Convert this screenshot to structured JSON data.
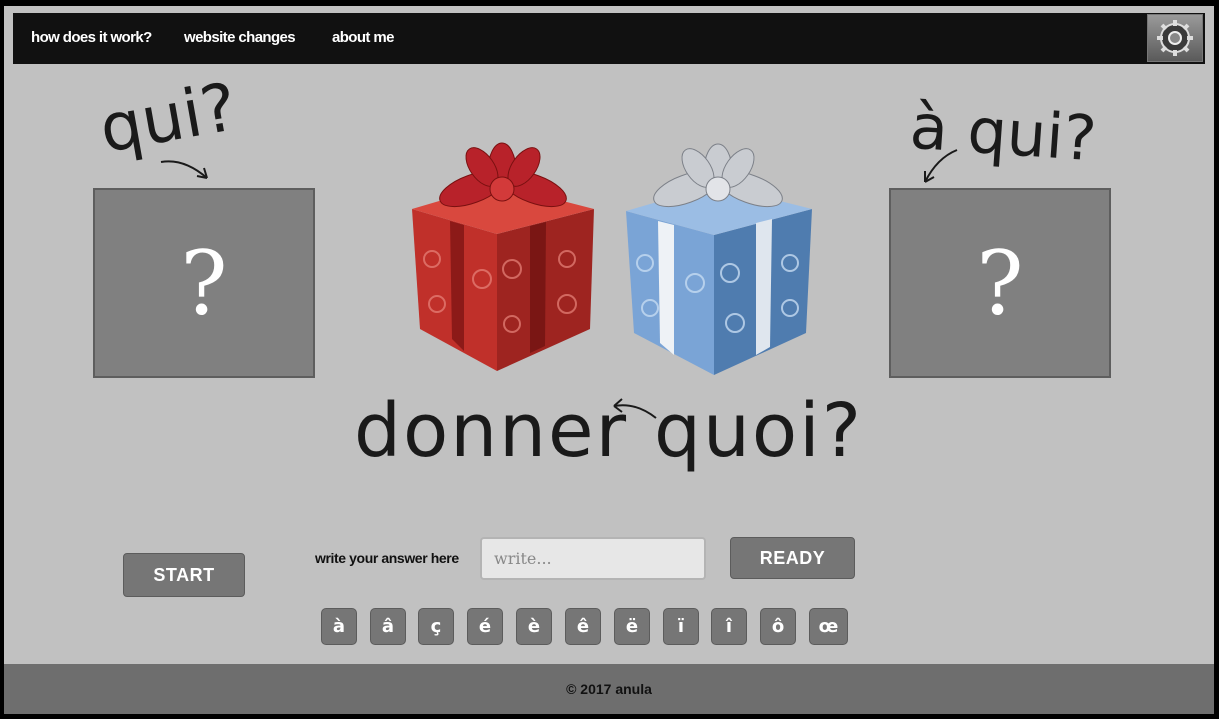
{
  "nav": {
    "items": [
      {
        "label": "how does it work?"
      },
      {
        "label": "website changes"
      },
      {
        "label": "about me"
      }
    ],
    "settings_icon": "gear-icon"
  },
  "left_panel": {
    "heading": "qui?",
    "placeholder": "?"
  },
  "right_panel": {
    "heading": "à qui?",
    "placeholder": "?"
  },
  "center": {
    "verb": "donner",
    "question": "quoi?",
    "gifts": [
      "red-gift-icon",
      "blue-gift-icon"
    ]
  },
  "controls": {
    "start_label": "START",
    "answer_label": "write your answer here",
    "answer_placeholder": "write...",
    "answer_value": "",
    "ready_label": "READY"
  },
  "special_chars": [
    "à",
    "â",
    "ç",
    "é",
    "è",
    "ê",
    "ë",
    "ï",
    "î",
    "ô",
    "œ"
  ],
  "footer": {
    "text": "© 2017 anula"
  },
  "colors": {
    "background": "#c1c1c1",
    "topbar": "#111111",
    "box": "#808080",
    "button": "#767676",
    "footer": "#6e6e6e",
    "gift_red": "#c0302a",
    "gift_blue": "#5b86b8"
  }
}
